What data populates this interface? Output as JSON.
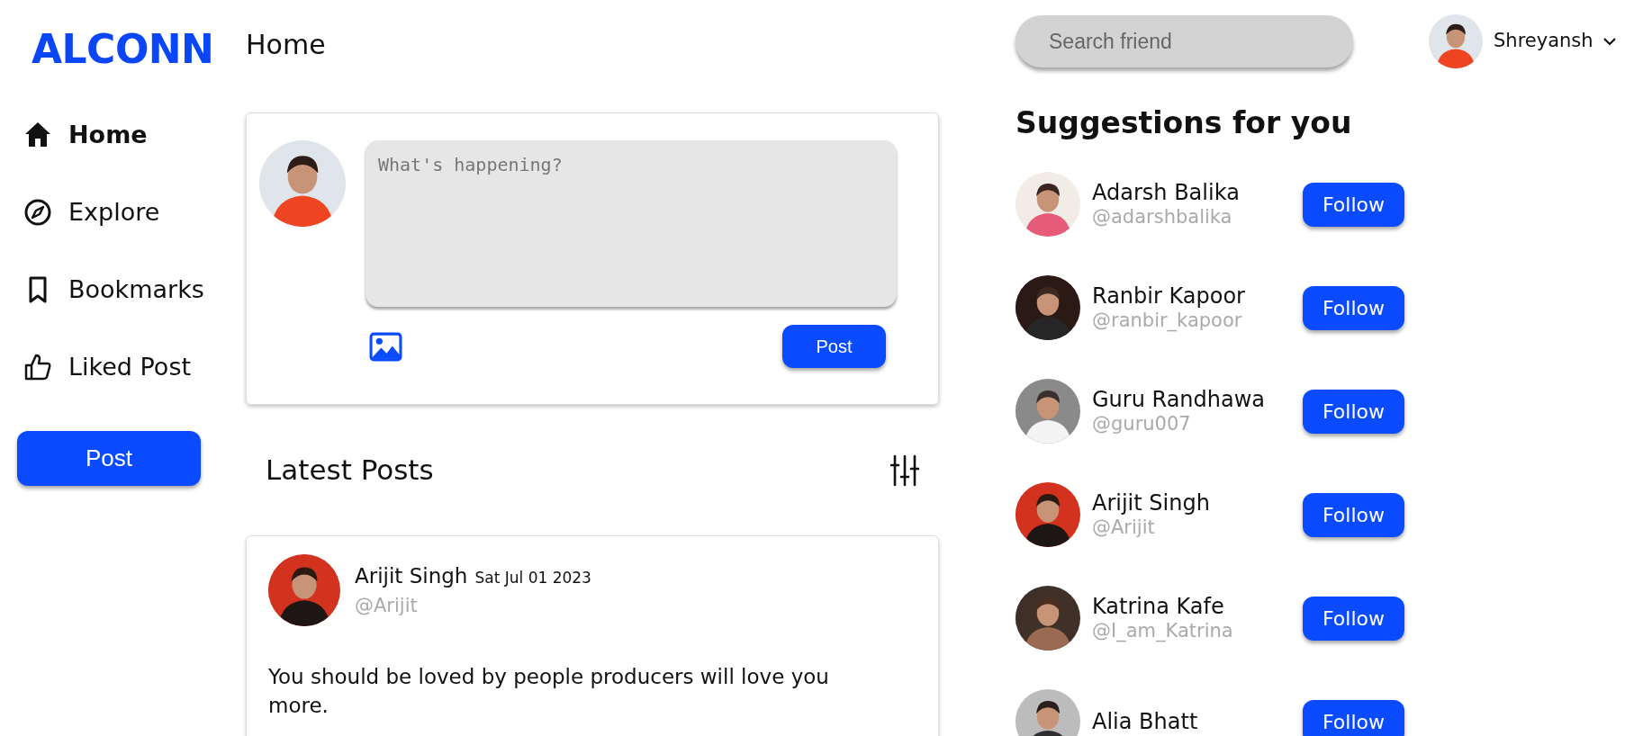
{
  "logo": "ALCONN",
  "page_title": "Home",
  "search": {
    "placeholder": "Search friend"
  },
  "user": {
    "name": "Shreyansh"
  },
  "sidebar": {
    "items": [
      {
        "kind": "home",
        "label": "Home",
        "selected": true
      },
      {
        "kind": "explore",
        "label": "Explore",
        "selected": false
      },
      {
        "kind": "bookmark",
        "label": "Bookmarks",
        "selected": false
      },
      {
        "kind": "like",
        "label": "Liked Post",
        "selected": false
      }
    ],
    "post_button": "Post"
  },
  "composer": {
    "placeholder": "What's happening?",
    "post_button": "Post"
  },
  "feed": {
    "title": "Latest Posts",
    "posts": [
      {
        "author": "Arijit Singh",
        "date": "Sat Jul 01 2023",
        "handle": "@Arijit",
        "text": "You should be loved by people producers will love you more."
      }
    ]
  },
  "suggestions": {
    "title": "Suggestions for you",
    "people": [
      {
        "name": "Adarsh Balika",
        "handle": "@adarshbalika",
        "button": "Follow"
      },
      {
        "name": "Ranbir Kapoor",
        "handle": "@ranbir_kapoor",
        "button": "Follow"
      },
      {
        "name": "Guru Randhawa",
        "handle": "@guru007",
        "button": "Follow"
      },
      {
        "name": "Arijit Singh",
        "handle": "@Arijit",
        "button": "Follow"
      },
      {
        "name": "Katrina Kafe",
        "handle": "@I_am_Katrina",
        "button": "Follow"
      },
      {
        "name": "Alia Bhatt",
        "button": "Follow"
      }
    ]
  }
}
